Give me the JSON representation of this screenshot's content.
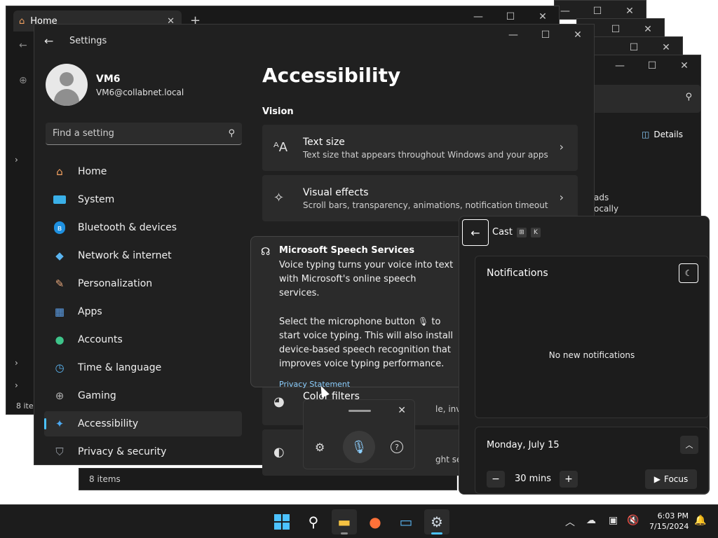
{
  "explorer": {
    "tab_title": "Home",
    "tab_close": "✕",
    "new_tab": "+",
    "status_items": "8 items",
    "details_label": "Details",
    "partial_text_1": "ads",
    "partial_text_2": "ocally",
    "partial_items": "8 item"
  },
  "settings": {
    "app_title": "Settings",
    "user_name": "VM6",
    "user_email": "VM6@collabnet.local",
    "search_placeholder": "Find a setting",
    "nav": [
      {
        "label": "Home",
        "icon": "home-icon"
      },
      {
        "label": "System",
        "icon": "system-icon"
      },
      {
        "label": "Bluetooth & devices",
        "icon": "bluetooth-icon"
      },
      {
        "label": "Network & internet",
        "icon": "wifi-icon"
      },
      {
        "label": "Personalization",
        "icon": "brush-icon"
      },
      {
        "label": "Apps",
        "icon": "apps-icon"
      },
      {
        "label": "Accounts",
        "icon": "accounts-icon"
      },
      {
        "label": "Time & language",
        "icon": "clock-icon"
      },
      {
        "label": "Gaming",
        "icon": "gamepad-icon"
      },
      {
        "label": "Accessibility",
        "icon": "accessibility-icon"
      },
      {
        "label": "Privacy & security",
        "icon": "shield-icon"
      }
    ],
    "active_nav": "Accessibility",
    "page_title": "Accessibility",
    "section_vision": "Vision",
    "cards": [
      {
        "title": "Text size",
        "subtitle": "Text size that appears throughout Windows and your apps",
        "icon": "text-size-icon"
      },
      {
        "title": "Visual effects",
        "subtitle": "Scroll bars, transparency, animations, notification timeout",
        "icon": "visual-effects-icon"
      },
      {
        "title": "Color filters",
        "subtitle": "le, inverted",
        "icon": "palette-icon"
      },
      {
        "title": "",
        "subtitle": "ght sensitiv",
        "icon": "contrast-icon"
      }
    ]
  },
  "speech_tooltip": {
    "title": "Microsoft Speech Services",
    "para1": "Voice typing turns your voice into text with Microsoft's online speech services.",
    "para2a": "Select the microphone button",
    "para2b": "to start voice typing. This will also install device-based speech recognition that improves voice typing performance.",
    "link": "Privacy Statement"
  },
  "notification_center": {
    "cast_label": "Cast",
    "kbd_win": "⊞",
    "kbd_k": "K",
    "notifications_title": "Notifications",
    "empty_text": "No new notifications",
    "date": "Monday, July 15",
    "focus_minutes": "30 mins",
    "focus_label": "Focus"
  },
  "taskbar": {
    "time": "6:03 PM",
    "date": "7/15/2024"
  },
  "colors": {
    "accent": "#4cc2ff",
    "window_bg": "#202020",
    "card_bg": "#2b2b2b"
  }
}
